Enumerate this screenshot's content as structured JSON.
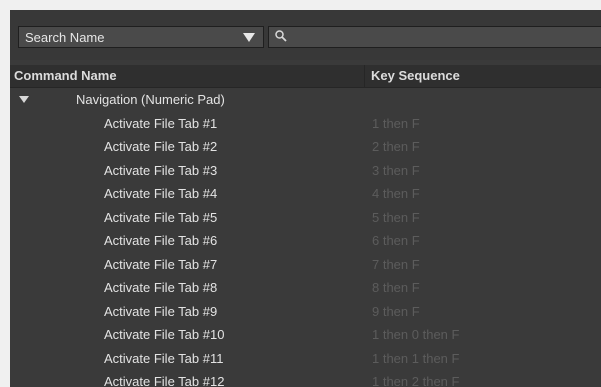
{
  "toolbar": {
    "search_mode": "Search Name",
    "search_value": "",
    "search_placeholder": ""
  },
  "columns": {
    "command": "Command Name",
    "key": "Key Sequence"
  },
  "group": {
    "name": "Navigation (Numeric Pad)",
    "expanded": true
  },
  "rows": [
    {
      "name": "Activate File Tab #1",
      "key": "1 then F"
    },
    {
      "name": "Activate File Tab #2",
      "key": "2 then F"
    },
    {
      "name": "Activate File Tab #3",
      "key": "3 then F"
    },
    {
      "name": "Activate File Tab #4",
      "key": "4 then F"
    },
    {
      "name": "Activate File Tab #5",
      "key": "5 then F"
    },
    {
      "name": "Activate File Tab #6",
      "key": "6 then F"
    },
    {
      "name": "Activate File Tab #7",
      "key": "7 then F"
    },
    {
      "name": "Activate File Tab #8",
      "key": "8 then F"
    },
    {
      "name": "Activate File Tab #9",
      "key": "9 then F"
    },
    {
      "name": "Activate File Tab #10",
      "key": "1 then 0 then F"
    },
    {
      "name": "Activate File Tab #11",
      "key": "1 then 1 then F"
    },
    {
      "name": "Activate File Tab #12",
      "key": "1 then 2 then F"
    }
  ],
  "colors": {
    "panel_bg": "#3a3a3a",
    "header_bg": "#2f2f2f",
    "text": "#e3e3e3",
    "key_text": "#5c5c5c"
  }
}
